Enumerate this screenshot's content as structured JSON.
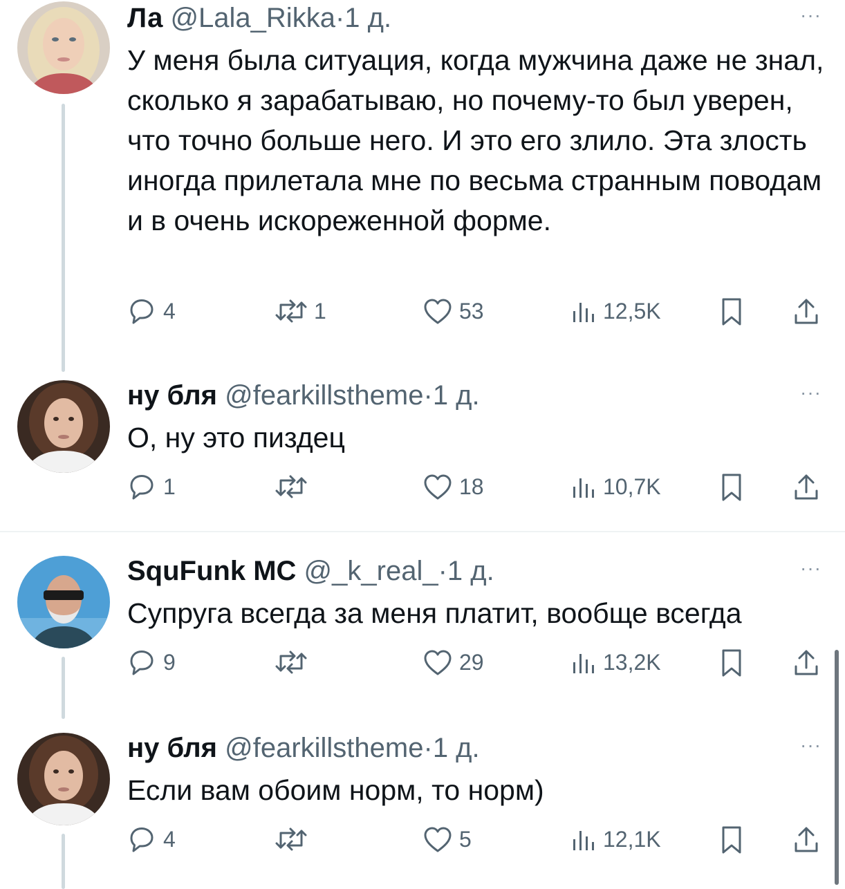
{
  "colors": {
    "text": "#0f1419",
    "muted": "#536471",
    "line": "#cfd9de",
    "divider": "#eff3f4"
  },
  "icons": {
    "reply": "reply-icon",
    "retweet": "retweet-icon",
    "like": "heart-icon",
    "views": "views-icon",
    "bookmark": "bookmark-icon",
    "share": "share-icon",
    "more": "more-icon"
  },
  "tweets": [
    {
      "name": "Ла",
      "handle": "@Lala_Rikka",
      "dot": "·",
      "time": "1 д.",
      "more": "···",
      "text": "У меня была ситуация, когда мужчина даже не знал, сколько я зарабатываю, но почему-то был уверен, что точно больше него. И это его злило. Эта злость иногда прилетала мне по весьма странным поводам и в очень искореженной форме.",
      "replies": "4",
      "retweets": "1",
      "likes": "53",
      "views": "12,5K"
    },
    {
      "name": "ну бля",
      "handle": "@fearkillstheme",
      "dot": "·",
      "time": "1 д.",
      "more": "···",
      "text": "О, ну это пиздец",
      "replies": "1",
      "retweets": "",
      "likes": "18",
      "views": "10,7K"
    },
    {
      "name": "SquFunk MC",
      "handle": "@_k_real_",
      "dot": "·",
      "time": "1 д.",
      "more": "···",
      "text": "Супруга всегда за меня платит, вообще всегда",
      "replies": "9",
      "retweets": "",
      "likes": "29",
      "views": "13,2K"
    },
    {
      "name": "ну бля",
      "handle": "@fearkillstheme",
      "dot": "·",
      "time": "1 д.",
      "more": "···",
      "text": "Если вам обоим норм, то норм)",
      "replies": "4",
      "retweets": "",
      "likes": "5",
      "views": "12,1K"
    }
  ]
}
